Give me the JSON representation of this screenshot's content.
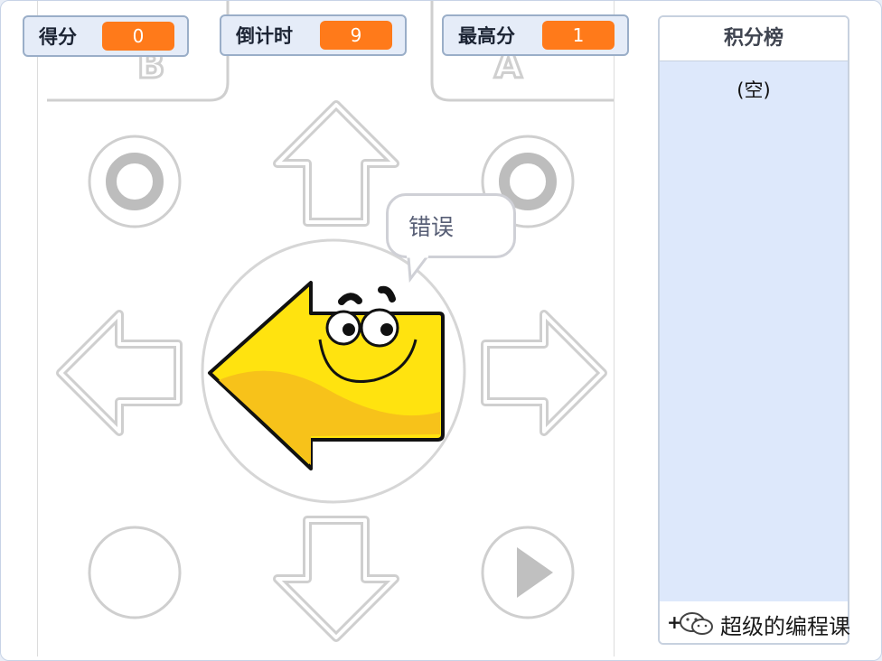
{
  "monitors": [
    {
      "label": "得分",
      "value": "0"
    },
    {
      "label": "倒计时",
      "value": "9"
    },
    {
      "label": "最高分",
      "value": "1"
    }
  ],
  "leaderboard": {
    "title": "积分榜",
    "empty_text": "(空)",
    "add_symbol": "+"
  },
  "speech_bubble": {
    "text": "错误"
  },
  "sprite": {
    "name": "left-arrow",
    "direction": "left",
    "expression": "smiling"
  },
  "controller": {
    "buttons": [
      "B",
      "A",
      "up-arrow",
      "down-arrow",
      "left-arrow",
      "right-arrow",
      "circle-left",
      "circle-right",
      "blank-round",
      "play"
    ]
  },
  "watermark": {
    "text": "超级的编程课"
  },
  "colors": {
    "accent": "#ff7a1a",
    "list_bg": "#dde8fb",
    "sprite_yellow": "#ffe30f"
  }
}
